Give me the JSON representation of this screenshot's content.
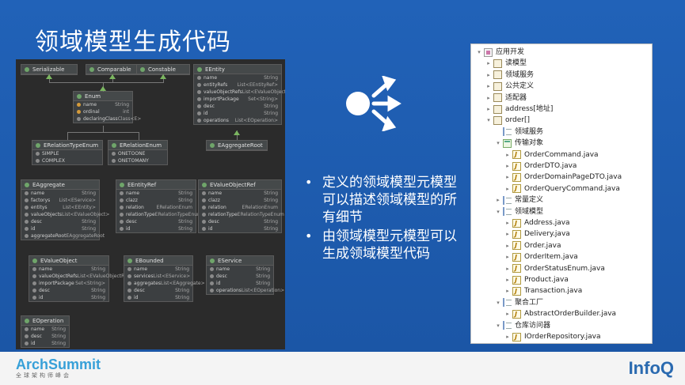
{
  "title": "领域模型生成代码",
  "uml": {
    "boxes": [
      {
        "name": "Serializable",
        "rows": []
      },
      {
        "name": "Comparable",
        "rows": []
      },
      {
        "name": "Constable",
        "rows": []
      },
      {
        "name": "EEntity",
        "rows": [
          [
            "name",
            "String"
          ],
          [
            "entityRefs",
            "List<EEntityRef>"
          ],
          [
            "valueObjectRefs",
            "List<EValueObjectRef>"
          ],
          [
            "importPackage",
            "Set<String>"
          ],
          [
            "desc",
            "String"
          ],
          [
            "id",
            "String"
          ],
          [
            "operations",
            "List<EOperation>"
          ]
        ]
      },
      {
        "name": "Enum",
        "rows": [
          [
            "name",
            "String"
          ],
          [
            "ordinal",
            "int"
          ],
          [
            "declaringClass",
            "Class<E>"
          ]
        ]
      },
      {
        "name": "ERelationTypeEnum",
        "rows": [
          [
            "SIMPLE",
            ""
          ],
          [
            "COMPLEX",
            ""
          ]
        ]
      },
      {
        "name": "ERelationEnum",
        "rows": [
          [
            "ONETOONE",
            ""
          ],
          [
            "ONETOMANY",
            ""
          ]
        ]
      },
      {
        "name": "EAggregateRoot",
        "rows": []
      },
      {
        "name": "EAggregate",
        "rows": [
          [
            "name",
            "String"
          ],
          [
            "factorys",
            "List<EService>"
          ],
          [
            "entitys",
            "List<EEntity>"
          ],
          [
            "valueObjects",
            "List<EValueObject>"
          ],
          [
            "desc",
            "String"
          ],
          [
            "id",
            "String"
          ],
          [
            "aggregateRoot",
            "EAggregateRoot"
          ]
        ]
      },
      {
        "name": "EEntityRef",
        "rows": [
          [
            "name",
            "String"
          ],
          [
            "clazz",
            "String"
          ],
          [
            "relation",
            "ERelationEnum"
          ],
          [
            "relationType",
            "ERelationTypeEnum"
          ],
          [
            "desc",
            "String"
          ],
          [
            "id",
            "String"
          ]
        ]
      },
      {
        "name": "EValueObjectRef",
        "rows": [
          [
            "name",
            "String"
          ],
          [
            "clazz",
            "String"
          ],
          [
            "relation",
            "ERelationEnum"
          ],
          [
            "relationType",
            "ERelationTypeEnum"
          ],
          [
            "desc",
            "String"
          ],
          [
            "id",
            "String"
          ]
        ]
      },
      {
        "name": "EValueObject",
        "rows": [
          [
            "name",
            "String"
          ],
          [
            "valueObjectRefs",
            "List<EValueObjectRef>"
          ],
          [
            "importPackage",
            "Set<String>"
          ],
          [
            "desc",
            "String"
          ],
          [
            "id",
            "String"
          ]
        ]
      },
      {
        "name": "EBounded",
        "rows": [
          [
            "name",
            "String"
          ],
          [
            "services",
            "List<EService>"
          ],
          [
            "aggregates",
            "List<EAggregate>"
          ],
          [
            "desc",
            "String"
          ],
          [
            "id",
            "String"
          ]
        ]
      },
      {
        "name": "EService",
        "rows": [
          [
            "name",
            "String"
          ],
          [
            "desc",
            "String"
          ],
          [
            "id",
            "String"
          ],
          [
            "operations",
            "List<EOperation>"
          ]
        ]
      },
      {
        "name": "EOperation",
        "rows": [
          [
            "name",
            "String"
          ],
          [
            "desc",
            "String"
          ],
          [
            "id",
            "String"
          ]
        ]
      }
    ]
  },
  "bullets": [
    "定义的领域模型元模型可以描述领域模型的所有细节",
    "由领域模型元模型可以生成领域模型代码"
  ],
  "tree": {
    "items": [
      {
        "label": "应用开发",
        "icon": "root",
        "twisty": "▾",
        "indent": 0
      },
      {
        "label": "读模型",
        "icon": "pkg",
        "twisty": "▸",
        "indent": 1
      },
      {
        "label": "领域服务",
        "icon": "pkg",
        "twisty": "▸",
        "indent": 1
      },
      {
        "label": "公共定义",
        "icon": "pkg",
        "twisty": "▸",
        "indent": 1
      },
      {
        "label": "适配器",
        "icon": "pkg",
        "twisty": "▸",
        "indent": 1
      },
      {
        "label": "address[地址]",
        "icon": "pkg",
        "twisty": "▸",
        "indent": 1
      },
      {
        "label": "order[]",
        "icon": "pkg",
        "twisty": "▾",
        "indent": 1
      },
      {
        "label": "领域服务",
        "icon": "lst",
        "twisty": "",
        "indent": 2
      },
      {
        "label": "传输对象",
        "icon": "cal",
        "twisty": "▾",
        "indent": 2
      },
      {
        "label": "OrderCommand.java",
        "icon": "java",
        "twisty": "▸",
        "indent": 3
      },
      {
        "label": "OrderDTO.java",
        "icon": "java",
        "twisty": "▸",
        "indent": 3
      },
      {
        "label": "OrderDomainPageDTO.java",
        "icon": "java",
        "twisty": "▸",
        "indent": 3
      },
      {
        "label": "OrderQueryCommand.java",
        "icon": "java",
        "twisty": "▸",
        "indent": 3
      },
      {
        "label": "常量定义",
        "icon": "lst",
        "twisty": "▸",
        "indent": 2
      },
      {
        "label": "领域模型",
        "icon": "lst",
        "twisty": "▾",
        "indent": 2
      },
      {
        "label": "Address.java",
        "icon": "java",
        "twisty": "▸",
        "indent": 3
      },
      {
        "label": "Delivery.java",
        "icon": "java",
        "twisty": "▸",
        "indent": 3
      },
      {
        "label": "Order.java",
        "icon": "java",
        "twisty": "▸",
        "indent": 3
      },
      {
        "label": "OrderItem.java",
        "icon": "java",
        "twisty": "▸",
        "indent": 3
      },
      {
        "label": "OrderStatusEnum.java",
        "icon": "java",
        "twisty": "▸",
        "indent": 3
      },
      {
        "label": "Product.java",
        "icon": "java",
        "twisty": "▸",
        "indent": 3
      },
      {
        "label": "Transaction.java",
        "icon": "java",
        "twisty": "▸",
        "indent": 3
      },
      {
        "label": "聚合工厂",
        "icon": "lst",
        "twisty": "▾",
        "indent": 2
      },
      {
        "label": "AbstractOrderBuilder.java",
        "icon": "java",
        "twisty": "▸",
        "indent": 3
      },
      {
        "label": "仓库访问器",
        "icon": "lst",
        "twisty": "▾",
        "indent": 2
      },
      {
        "label": "IOrderRepository.java",
        "icon": "java",
        "twisty": "▸",
        "indent": 3
      }
    ]
  },
  "footer": {
    "left_logo_a": "Arch",
    "left_logo_b": "Summit",
    "left_sub": "全球架构师峰会",
    "right_logo_a": "InfoQ",
    "right_logo_b": ""
  }
}
